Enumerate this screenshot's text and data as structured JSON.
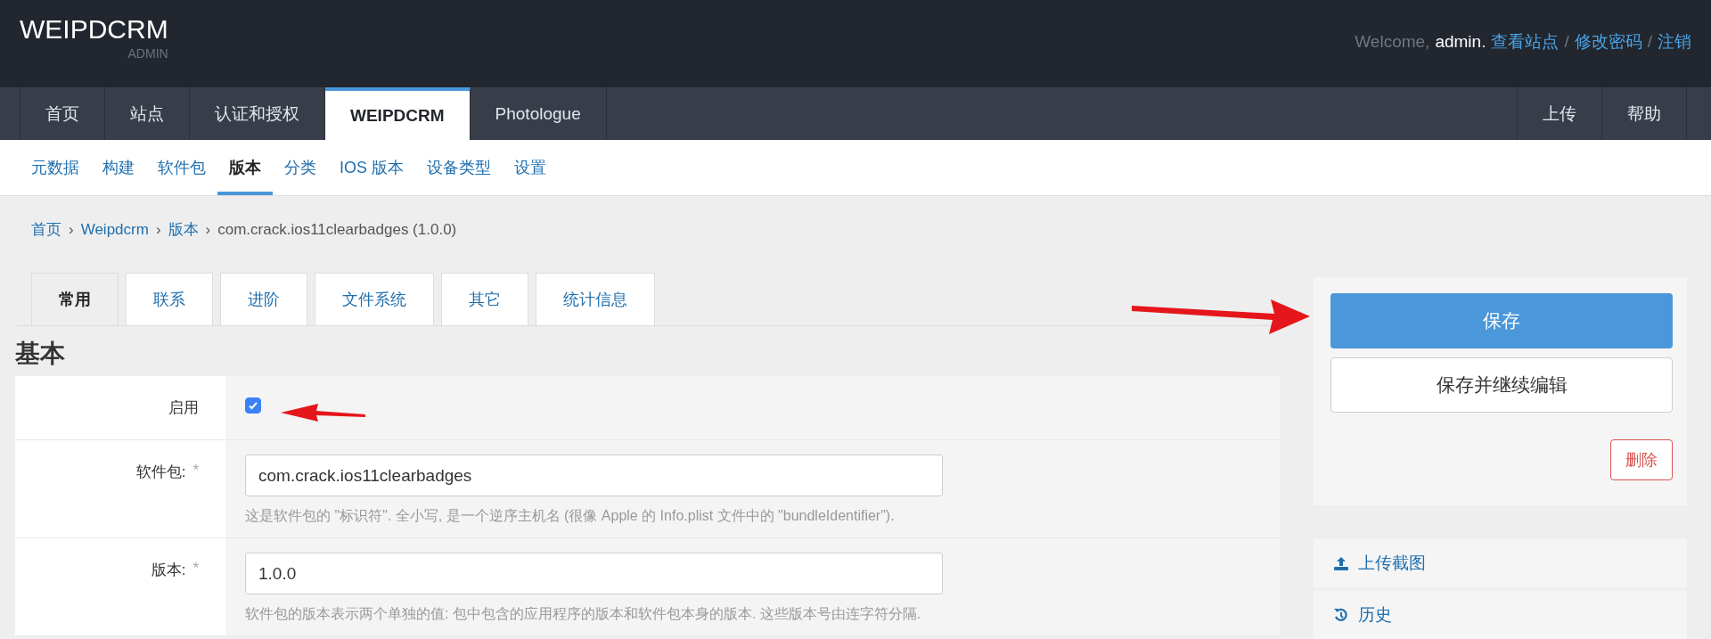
{
  "header": {
    "brand": "WEIPDCRM",
    "subtitle": "ADMIN",
    "welcome": "Welcome,",
    "user": "admin.",
    "links": [
      {
        "label": "查看站点"
      },
      {
        "label": "修改密码"
      },
      {
        "label": "注销"
      }
    ],
    "separator": "/"
  },
  "nav": {
    "items": [
      {
        "label": "首页",
        "selected": false
      },
      {
        "label": "站点",
        "selected": false
      },
      {
        "label": "认证和授权",
        "selected": false
      },
      {
        "label": "WEIPDCRM",
        "selected": true
      },
      {
        "label": "Photologue",
        "selected": false
      }
    ],
    "right_items": [
      {
        "label": "上传"
      },
      {
        "label": "帮助"
      }
    ]
  },
  "subnav": [
    {
      "label": "元数据",
      "selected": false
    },
    {
      "label": "构建",
      "selected": false
    },
    {
      "label": "软件包",
      "selected": false
    },
    {
      "label": "版本",
      "selected": true
    },
    {
      "label": "分类",
      "selected": false
    },
    {
      "label": "IOS 版本",
      "selected": false
    },
    {
      "label": "设备类型",
      "selected": false
    },
    {
      "label": "设置",
      "selected": false
    }
  ],
  "breadcrumb": {
    "links": [
      "首页",
      "Weipdcrm",
      "版本"
    ],
    "separator": "›",
    "current": "com.crack.ios11clearbadges (1.0.0)"
  },
  "tabs": [
    {
      "label": "常用",
      "selected": true
    },
    {
      "label": "联系",
      "selected": false
    },
    {
      "label": "进阶",
      "selected": false
    },
    {
      "label": "文件系统",
      "selected": false
    },
    {
      "label": "其它",
      "selected": false
    },
    {
      "label": "统计信息",
      "selected": false
    }
  ],
  "section_title": "基本",
  "fields": [
    {
      "kind": "checkbox",
      "label": "启用",
      "checked": true
    },
    {
      "kind": "text",
      "label": "软件包:",
      "required_mark": "*",
      "value": "com.crack.ios11clearbadges",
      "help": "这是软件包的 \"标识符\". 全小写, 是一个逆序主机名 (很像 Apple 的 Info.plist 文件中的 \"bundleIdentifier\")."
    },
    {
      "kind": "text",
      "label": "版本:",
      "required_mark": "*",
      "value": "1.0.0",
      "help": "软件包的版本表示两个单独的值: 包中包含的应用程序的版本和软件包本身的版本. 这些版本号由连字符分隔."
    }
  ],
  "actions": {
    "save": "保存",
    "save_continue": "保存并继续编辑",
    "delete": "删除"
  },
  "side_links": [
    {
      "kind": "upload",
      "label": "上传截图"
    },
    {
      "kind": "history",
      "label": "历史"
    }
  ]
}
